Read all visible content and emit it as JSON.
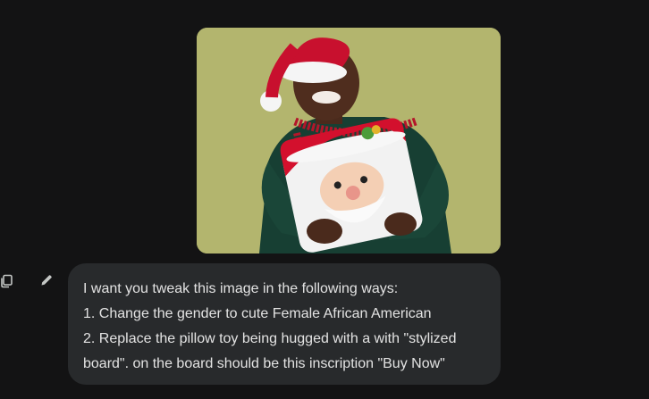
{
  "image": {
    "alt_icon": "uploaded-photo",
    "background_color": "#b3b56e"
  },
  "actions": {
    "copy_icon": "copy-icon",
    "edit_icon": "pencil-icon"
  },
  "message": {
    "lines": [
      "I want you tweak this image in the following ways:",
      "1. Change the gender to cute Female African American",
      "2. Replace the pillow toy being hugged with a with \"stylized",
      "board\". on the board should be this inscription \"Buy Now\""
    ]
  },
  "colors": {
    "page_background": "#131314",
    "bubble_background": "#282a2c",
    "text": "#e3e3e3",
    "icon": "#c4c7c5"
  }
}
